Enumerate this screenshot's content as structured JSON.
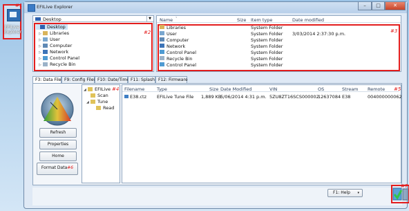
{
  "desktop_icon": {
    "label": "EFILive Explorer",
    "tag": "#1"
  },
  "window": {
    "title": "EFILive Explorer",
    "close_glyph": "✕",
    "min_glyph": "–",
    "max_glyph": "□"
  },
  "tree": {
    "selector": "Desktop",
    "tag": "#2",
    "items": [
      {
        "label": "Desktop",
        "icon": "desktop-icon"
      },
      {
        "label": "Libraries",
        "icon": "libraries-icon"
      },
      {
        "label": "User",
        "icon": "user-icon"
      },
      {
        "label": "Computer",
        "icon": "computer-icon"
      },
      {
        "label": "Network",
        "icon": "network-icon"
      },
      {
        "label": "Control Panel",
        "icon": "control-panel-icon"
      },
      {
        "label": "Recycle Bin",
        "icon": "recycle-bin-icon"
      }
    ]
  },
  "list": {
    "tag": "#3",
    "headers": {
      "name": "Name",
      "sort": "ˇ",
      "size": "Size",
      "type": "Item type",
      "date": "Date modified"
    },
    "rows": [
      {
        "name": "Libraries",
        "type": "System Folder",
        "date": ""
      },
      {
        "name": "User",
        "type": "System Folder",
        "date": "3/03/2014 2:37:30 p.m."
      },
      {
        "name": "Computer",
        "type": "System Folder",
        "date": ""
      },
      {
        "name": "Network",
        "type": "System Folder",
        "date": ""
      },
      {
        "name": "Control Panel",
        "type": "System Folder",
        "date": ""
      },
      {
        "name": "Recycle Bin",
        "type": "System Folder",
        "date": ""
      },
      {
        "name": "Control Panel",
        "type": "System Folder",
        "date": ""
      }
    ]
  },
  "tabs": [
    "F3: Data Files",
    "F9: Config Files",
    "F10: Date/Time",
    "F11: Splash",
    "F12: Firmware"
  ],
  "side_buttons": {
    "refresh": "Refresh",
    "properties": "Properties",
    "home": "Home",
    "format": "Format Data",
    "format_tag": "#6"
  },
  "folder_tree": {
    "tag": "#4",
    "items": [
      "EFILive",
      "Scan",
      "Tune",
      "Read"
    ]
  },
  "files": {
    "tag": "#5",
    "headers": {
      "filename": "Filename",
      "type": "Type",
      "size": "Size",
      "date": "Date Modified",
      "vin": "VIN",
      "os": "OS",
      "stream": "Stream",
      "remote": "Remote"
    },
    "rows": [
      {
        "filename": "E38.ctz",
        "type": "EFILive Tune File",
        "size": "1,889 KB",
        "date": "5/06/2014 4:31 p.m.",
        "vin": "5ZU8ZT16SCS000002",
        "os": "12637084",
        "stream": "E38",
        "remote": "004000000062"
      }
    ]
  },
  "help": {
    "label": "F1: Help",
    "caret": "▾"
  },
  "bottom_tag": "#7",
  "colors": {
    "accent_red": "#e21d1d",
    "window_bg": "#dfe9f5",
    "selection": "#cce4f7"
  }
}
